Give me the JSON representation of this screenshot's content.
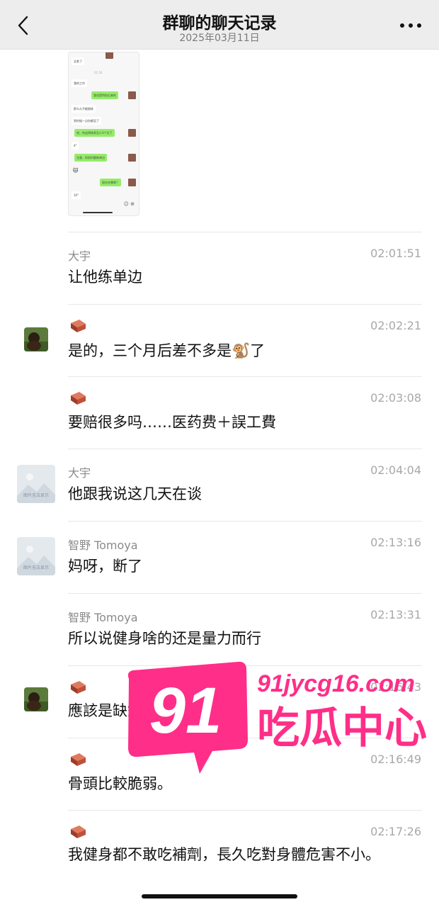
{
  "header": {
    "title": "群聊的聊天记录",
    "date": "2025年03月11日"
  },
  "thumbnail": {
    "bubbles": [
      "全差了",
      "我的工作",
      "我也是特别后来的",
      "那么久不能锻炼",
      "到时候一点伤都没了",
      "哎，你这得休养至少3个月了",
      "4\"",
      "注意，你别时要练单边",
      "现在在哪呢？",
      "10\""
    ],
    "timestamp": "01:54"
  },
  "messages": [
    {
      "sender": "大宇",
      "time": "02:01:51",
      "text": "让他练单边",
      "avatar": "none"
    },
    {
      "sender": "",
      "time": "02:02:21",
      "text": "是的，三个月后差不多是🐒了",
      "avatar": "photo"
    },
    {
      "sender": "",
      "time": "02:03:08",
      "text": "要赔很多吗……医药费＋誤工費",
      "avatar": "none"
    },
    {
      "sender": "大宇",
      "time": "02:04:04",
      "text": "他跟我说这几天在谈",
      "avatar": "placeholder"
    },
    {
      "sender": "智野 Tomoya",
      "time": "02:13:16",
      "text": "妈呀，断了",
      "avatar": "placeholder"
    },
    {
      "sender": "智野 Tomoya",
      "time": "02:13:31",
      "text": "所以说健身啥的还是量力而行",
      "avatar": "none"
    },
    {
      "sender": "",
      "time": "02:16:43",
      "text": "應該是缺鈣",
      "avatar": "photo"
    },
    {
      "sender": "",
      "time": "02:16:49",
      "text": "骨頭比較脆弱。",
      "avatar": "none"
    },
    {
      "sender": "",
      "time": "02:17:26",
      "text": "我健身都不敢吃補劑，長久吃對身體危害不小。",
      "avatar": "none"
    }
  ],
  "placeholder_caption": "图片无法显示",
  "watermark": {
    "number": "91",
    "url": "91jycg16.com",
    "name": "吃瓜中心"
  },
  "colors": {
    "header_bg": "#ededed",
    "watermark": "#ff2e88",
    "bubble_green": "#95ec69"
  },
  "icons": [
    "back-chevron-icon",
    "more-dots-icon",
    "brick-emoji-icon",
    "image-placeholder-icon"
  ]
}
